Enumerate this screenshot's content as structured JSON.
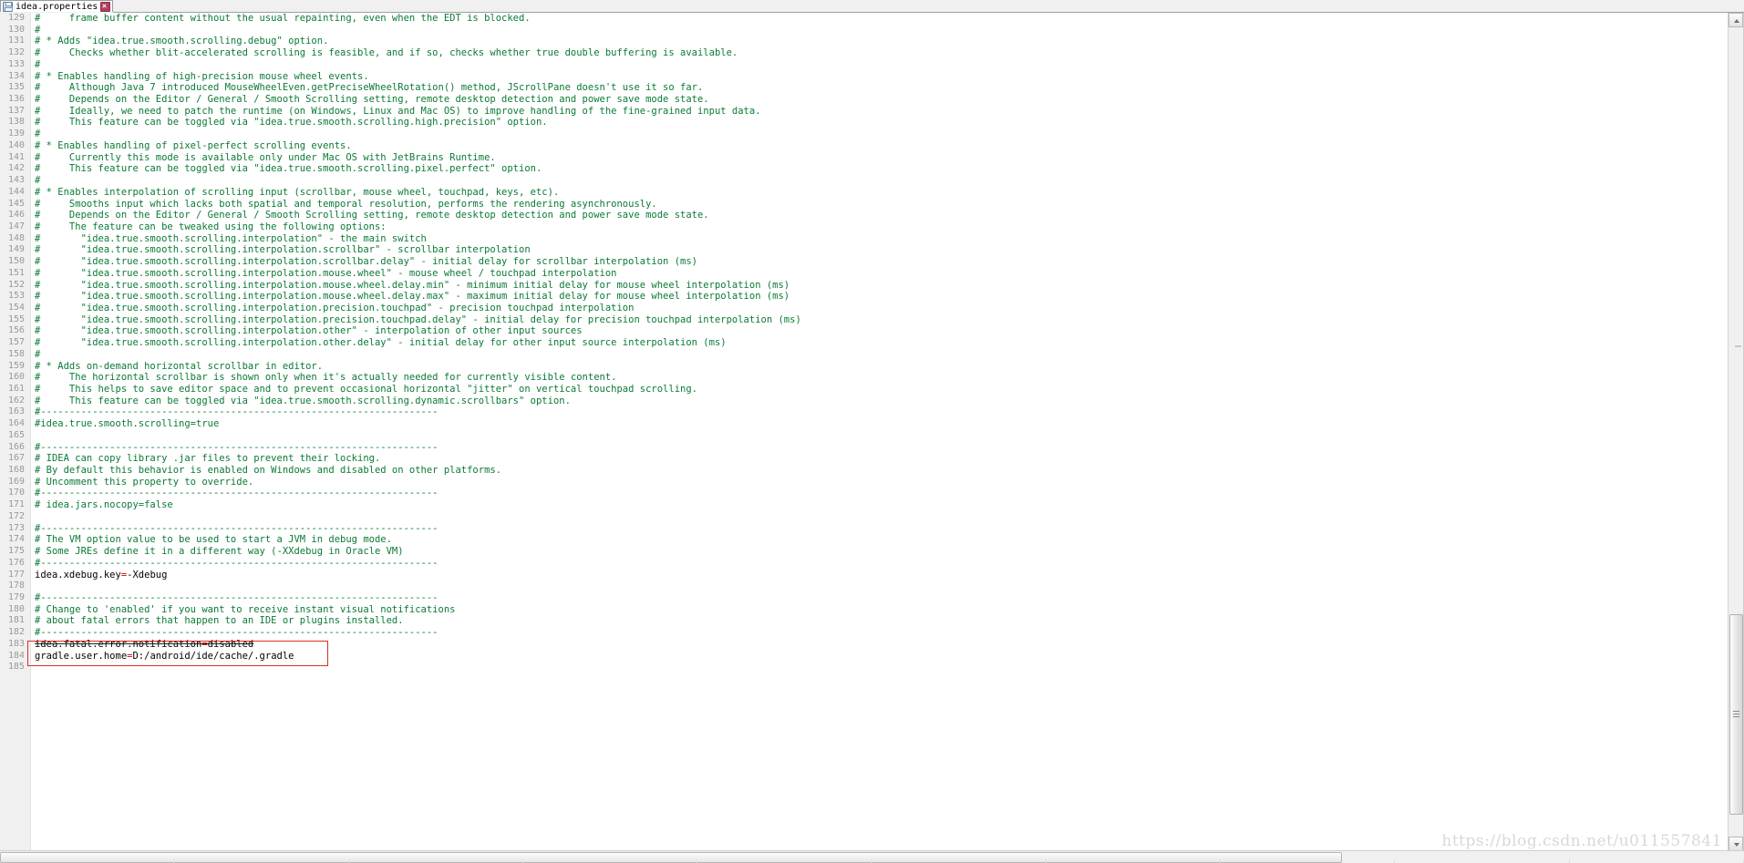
{
  "window": {
    "app": "IntelliJ IDEA Editor",
    "watermark": "https://blog.csdn.net/u011557841"
  },
  "tab": {
    "title": "idea.properties",
    "save_icon": "floppy-disk-icon",
    "close_icon": "close-icon",
    "modified": true
  },
  "editor": {
    "language": "properties",
    "first_visible_line": 129,
    "last_visible_line": 185,
    "colors": {
      "comment": "#0b7a34",
      "key": "#000000",
      "separator": "#cc0000",
      "value": "#000000",
      "gutter_bg": "#f0f0f0",
      "line_number": "#999999",
      "background": "#ffffff",
      "annotation_box": "#d93025"
    },
    "annotation": {
      "type": "red-rectangle",
      "covers_lines": [
        183,
        184
      ]
    },
    "lines": [
      {
        "n": 129,
        "kind": "comment",
        "text": "#     frame buffer content without the usual repainting, even when the EDT is blocked."
      },
      {
        "n": 130,
        "kind": "comment",
        "text": "#"
      },
      {
        "n": 131,
        "kind": "comment",
        "text": "# * Adds \"idea.true.smooth.scrolling.debug\" option."
      },
      {
        "n": 132,
        "kind": "comment",
        "text": "#     Checks whether blit-accelerated scrolling is feasible, and if so, checks whether true double buffering is available."
      },
      {
        "n": 133,
        "kind": "comment",
        "text": "#"
      },
      {
        "n": 134,
        "kind": "comment",
        "text": "# * Enables handling of high-precision mouse wheel events."
      },
      {
        "n": 135,
        "kind": "comment",
        "text": "#     Although Java 7 introduced MouseWheelEven.getPreciseWheelRotation() method, JScrollPane doesn't use it so far."
      },
      {
        "n": 136,
        "kind": "comment",
        "text": "#     Depends on the Editor / General / Smooth Scrolling setting, remote desktop detection and power save mode state."
      },
      {
        "n": 137,
        "kind": "comment",
        "text": "#     Ideally, we need to patch the runtime (on Windows, Linux and Mac OS) to improve handling of the fine-grained input data."
      },
      {
        "n": 138,
        "kind": "comment",
        "text": "#     This feature can be toggled via \"idea.true.smooth.scrolling.high.precision\" option."
      },
      {
        "n": 139,
        "kind": "comment",
        "text": "#"
      },
      {
        "n": 140,
        "kind": "comment",
        "text": "# * Enables handling of pixel-perfect scrolling events."
      },
      {
        "n": 141,
        "kind": "comment",
        "text": "#     Currently this mode is available only under Mac OS with JetBrains Runtime."
      },
      {
        "n": 142,
        "kind": "comment",
        "text": "#     This feature can be toggled via \"idea.true.smooth.scrolling.pixel.perfect\" option."
      },
      {
        "n": 143,
        "kind": "comment",
        "text": "#"
      },
      {
        "n": 144,
        "kind": "comment",
        "text": "# * Enables interpolation of scrolling input (scrollbar, mouse wheel, touchpad, keys, etc)."
      },
      {
        "n": 145,
        "kind": "comment",
        "text": "#     Smooths input which lacks both spatial and temporal resolution, performs the rendering asynchronously."
      },
      {
        "n": 146,
        "kind": "comment",
        "text": "#     Depends on the Editor / General / Smooth Scrolling setting, remote desktop detection and power save mode state."
      },
      {
        "n": 147,
        "kind": "comment",
        "text": "#     The feature can be tweaked using the following options:"
      },
      {
        "n": 148,
        "kind": "comment",
        "text": "#       \"idea.true.smooth.scrolling.interpolation\" - the main switch"
      },
      {
        "n": 149,
        "kind": "comment",
        "text": "#       \"idea.true.smooth.scrolling.interpolation.scrollbar\" - scrollbar interpolation"
      },
      {
        "n": 150,
        "kind": "comment",
        "text": "#       \"idea.true.smooth.scrolling.interpolation.scrollbar.delay\" - initial delay for scrollbar interpolation (ms)"
      },
      {
        "n": 151,
        "kind": "comment",
        "text": "#       \"idea.true.smooth.scrolling.interpolation.mouse.wheel\" - mouse wheel / touchpad interpolation"
      },
      {
        "n": 152,
        "kind": "comment",
        "text": "#       \"idea.true.smooth.scrolling.interpolation.mouse.wheel.delay.min\" - minimum initial delay for mouse wheel interpolation (ms)"
      },
      {
        "n": 153,
        "kind": "comment",
        "text": "#       \"idea.true.smooth.scrolling.interpolation.mouse.wheel.delay.max\" - maximum initial delay for mouse wheel interpolation (ms)"
      },
      {
        "n": 154,
        "kind": "comment",
        "text": "#       \"idea.true.smooth.scrolling.interpolation.precision.touchpad\" - precision touchpad interpolation"
      },
      {
        "n": 155,
        "kind": "comment",
        "text": "#       \"idea.true.smooth.scrolling.interpolation.precision.touchpad.delay\" - initial delay for precision touchpad interpolation (ms)"
      },
      {
        "n": 156,
        "kind": "comment",
        "text": "#       \"idea.true.smooth.scrolling.interpolation.other\" - interpolation of other input sources"
      },
      {
        "n": 157,
        "kind": "comment",
        "text": "#       \"idea.true.smooth.scrolling.interpolation.other.delay\" - initial delay for other input source interpolation (ms)"
      },
      {
        "n": 158,
        "kind": "comment",
        "text": "#"
      },
      {
        "n": 159,
        "kind": "comment",
        "text": "# * Adds on-demand horizontal scrollbar in editor."
      },
      {
        "n": 160,
        "kind": "comment",
        "text": "#     The horizontal scrollbar is shown only when it's actually needed for currently visible content."
      },
      {
        "n": 161,
        "kind": "comment",
        "text": "#     This helps to save editor space and to prevent occasional horizontal \"jitter\" on vertical touchpad scrolling."
      },
      {
        "n": 162,
        "kind": "comment",
        "text": "#     This feature can be toggled via \"idea.true.smooth.scrolling.dynamic.scrollbars\" option."
      },
      {
        "n": 163,
        "kind": "comment",
        "text": "#---------------------------------------------------------------------"
      },
      {
        "n": 164,
        "kind": "comment",
        "text": "#idea.true.smooth.scrolling=true"
      },
      {
        "n": 165,
        "kind": "blank",
        "text": ""
      },
      {
        "n": 166,
        "kind": "comment",
        "text": "#---------------------------------------------------------------------"
      },
      {
        "n": 167,
        "kind": "comment",
        "text": "# IDEA can copy library .jar files to prevent their locking."
      },
      {
        "n": 168,
        "kind": "comment",
        "text": "# By default this behavior is enabled on Windows and disabled on other platforms."
      },
      {
        "n": 169,
        "kind": "comment",
        "text": "# Uncomment this property to override."
      },
      {
        "n": 170,
        "kind": "comment",
        "text": "#---------------------------------------------------------------------"
      },
      {
        "n": 171,
        "kind": "comment",
        "text": "# idea.jars.nocopy=false"
      },
      {
        "n": 172,
        "kind": "blank",
        "text": ""
      },
      {
        "n": 173,
        "kind": "comment",
        "text": "#---------------------------------------------------------------------"
      },
      {
        "n": 174,
        "kind": "comment",
        "text": "# The VM option value to be used to start a JVM in debug mode."
      },
      {
        "n": 175,
        "kind": "comment",
        "text": "# Some JREs define it in a different way (-XXdebug in Oracle VM)"
      },
      {
        "n": 176,
        "kind": "comment",
        "text": "#---------------------------------------------------------------------"
      },
      {
        "n": 177,
        "kind": "property",
        "key": "idea.xdebug.key",
        "eq": "=",
        "value": "-Xdebug"
      },
      {
        "n": 178,
        "kind": "blank",
        "text": ""
      },
      {
        "n": 179,
        "kind": "comment",
        "text": "#---------------------------------------------------------------------"
      },
      {
        "n": 180,
        "kind": "comment",
        "text": "# Change to 'enabled' if you want to receive instant visual notifications"
      },
      {
        "n": 181,
        "kind": "comment",
        "text": "# about fatal errors that happen to an IDE or plugins installed."
      },
      {
        "n": 182,
        "kind": "comment",
        "text": "#---------------------------------------------------------------------"
      },
      {
        "n": 183,
        "kind": "property",
        "key": "idea.fatal.error.notification",
        "eq": "=",
        "value": "disabled",
        "struck": true
      },
      {
        "n": 184,
        "kind": "property",
        "key": "gradle.user.home",
        "eq": "=",
        "value": "D:/android/ide/cache/.gradle"
      },
      {
        "n": 185,
        "kind": "blank",
        "text": ""
      }
    ]
  },
  "scrollbars": {
    "vertical": {
      "up_icon": "caret-up-icon",
      "down_icon": "caret-down-icon",
      "thumb": "vertical-scroll-thumb"
    },
    "horizontal": {
      "thumb": "horizontal-scroll-thumb"
    }
  }
}
